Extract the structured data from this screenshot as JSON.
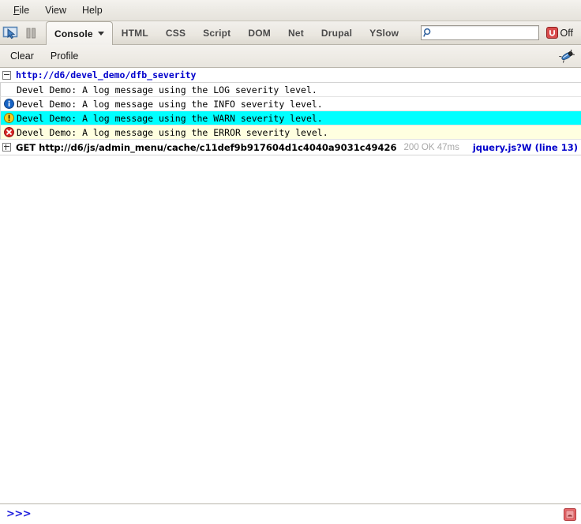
{
  "menubar": {
    "items": [
      {
        "label": "File",
        "accel": "F",
        "rest": "ile"
      },
      {
        "label": "View",
        "accel": "",
        "rest": "View"
      },
      {
        "label": "Help",
        "accel": "",
        "rest": "Help"
      }
    ]
  },
  "toolbar": {
    "inspect_icon": "inspect-cursor-icon",
    "pause_icon": "pause-icon",
    "tabs": [
      {
        "label": "Console",
        "active": true,
        "has_menu": true
      },
      {
        "label": "HTML",
        "active": false
      },
      {
        "label": "CSS",
        "active": false
      },
      {
        "label": "Script",
        "active": false
      },
      {
        "label": "DOM",
        "active": false
      },
      {
        "label": "Net",
        "active": false
      },
      {
        "label": "Drupal",
        "active": false
      },
      {
        "label": "YSlow",
        "active": false
      }
    ],
    "search": {
      "value": "",
      "placeholder": "",
      "icon": "search-icon"
    },
    "power": {
      "label": "Off",
      "icon": "firebug-power-icon",
      "color": "#cc3333"
    }
  },
  "subtoolbar": {
    "clear_label": "Clear",
    "profile_label": "Profile",
    "bug_icon": "firebug-bug-icon"
  },
  "console": {
    "group": {
      "url": "http://d6/devel_demo/dfb_severity",
      "expanded": true,
      "twisty": "minus-box-icon"
    },
    "messages": [
      {
        "severity": "log",
        "icon": null,
        "text": "Devel Demo: A log message using the LOG severity level.",
        "bg": "#ffffff"
      },
      {
        "severity": "info",
        "icon": "info-circle-icon",
        "text": "Devel Demo: A log message using the INFO severity level.",
        "bg": "#ffffff"
      },
      {
        "severity": "warn",
        "icon": "warning-circle-icon",
        "text": "Devel Demo: A log message using the WARN severity level.",
        "bg": "#00FFFF"
      },
      {
        "severity": "error",
        "icon": "error-circle-icon",
        "text": "Devel Demo: A log message using the ERROR severity level.",
        "bg": "#FFFFE0"
      }
    ],
    "network_request": {
      "twisty": "plus-box-icon",
      "method_and_url": "GET http://d6/js/admin_menu/cache/c11def9b917604d1c4040a9031c49426",
      "status": "200 OK 47ms",
      "source": "jquery.js?W (line 13)"
    }
  },
  "commandline": {
    "prompt": ">>>",
    "value": "",
    "placeholder": "",
    "popout_icon": "open-in-window-icon"
  }
}
